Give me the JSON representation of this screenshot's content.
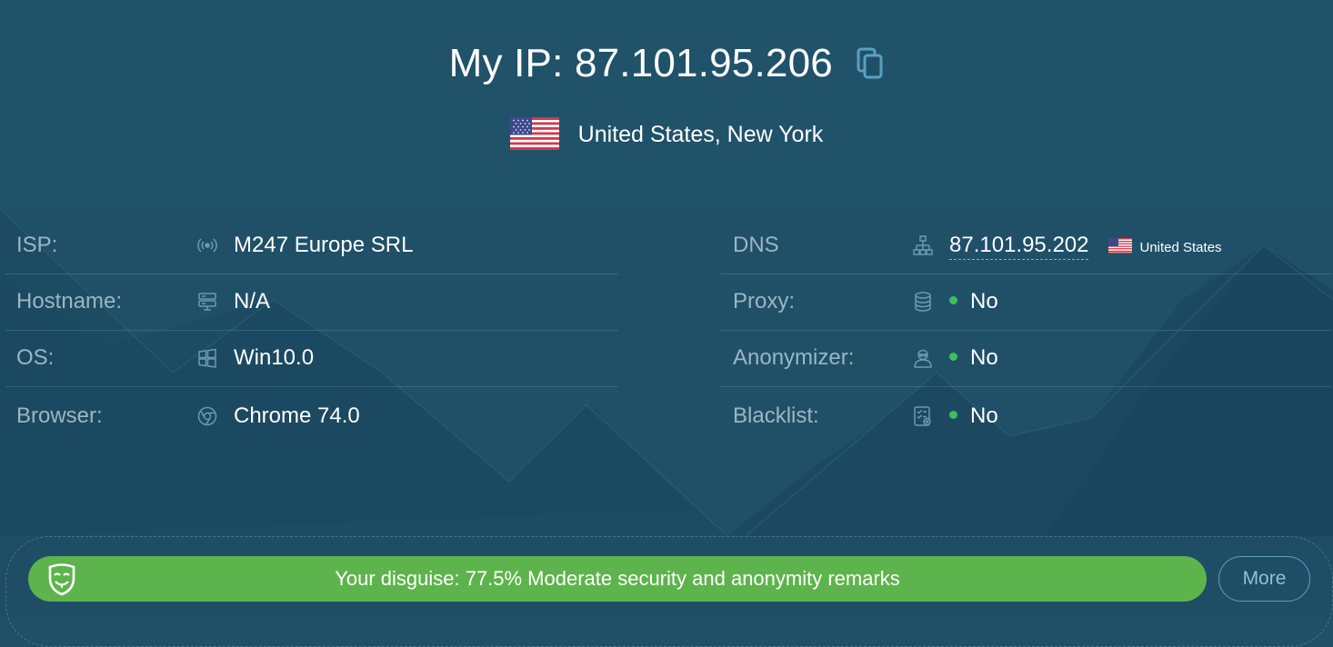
{
  "header": {
    "prefix": "My IP:",
    "ip": "87.101.95.206",
    "copy_icon": "copy-icon"
  },
  "location": {
    "flag": "us-flag",
    "text": "United States, New York"
  },
  "left_rows": [
    {
      "label": "ISP:",
      "icon": "antenna-icon",
      "value": "M247 Europe SRL"
    },
    {
      "label": "Hostname:",
      "icon": "server-icon",
      "value": "N/A"
    },
    {
      "label": "OS:",
      "icon": "windows-icon",
      "value": "Win10.0"
    },
    {
      "label": "Browser:",
      "icon": "chrome-icon",
      "value": "Chrome 74.0"
    }
  ],
  "right_rows": [
    {
      "label": "DNS",
      "icon": "network-icon",
      "value": "87.101.95.202",
      "country": "United States"
    },
    {
      "label": "Proxy:",
      "icon": "database-icon",
      "value": "No"
    },
    {
      "label": "Anonymizer:",
      "icon": "incognito-icon",
      "value": "No"
    },
    {
      "label": "Blacklist:",
      "icon": "checklist-icon",
      "value": "No"
    }
  ],
  "disguise": {
    "text": "Your disguise: 77.5% Moderate security and anonymity remarks",
    "icon": "mask-icon",
    "color": "#5eb44c"
  },
  "more_button": "More",
  "colors": {
    "background": "#1f5068",
    "label": "#9cb6c4",
    "status_dot": "#3fbf5a",
    "accent": "#7ab3d0"
  }
}
